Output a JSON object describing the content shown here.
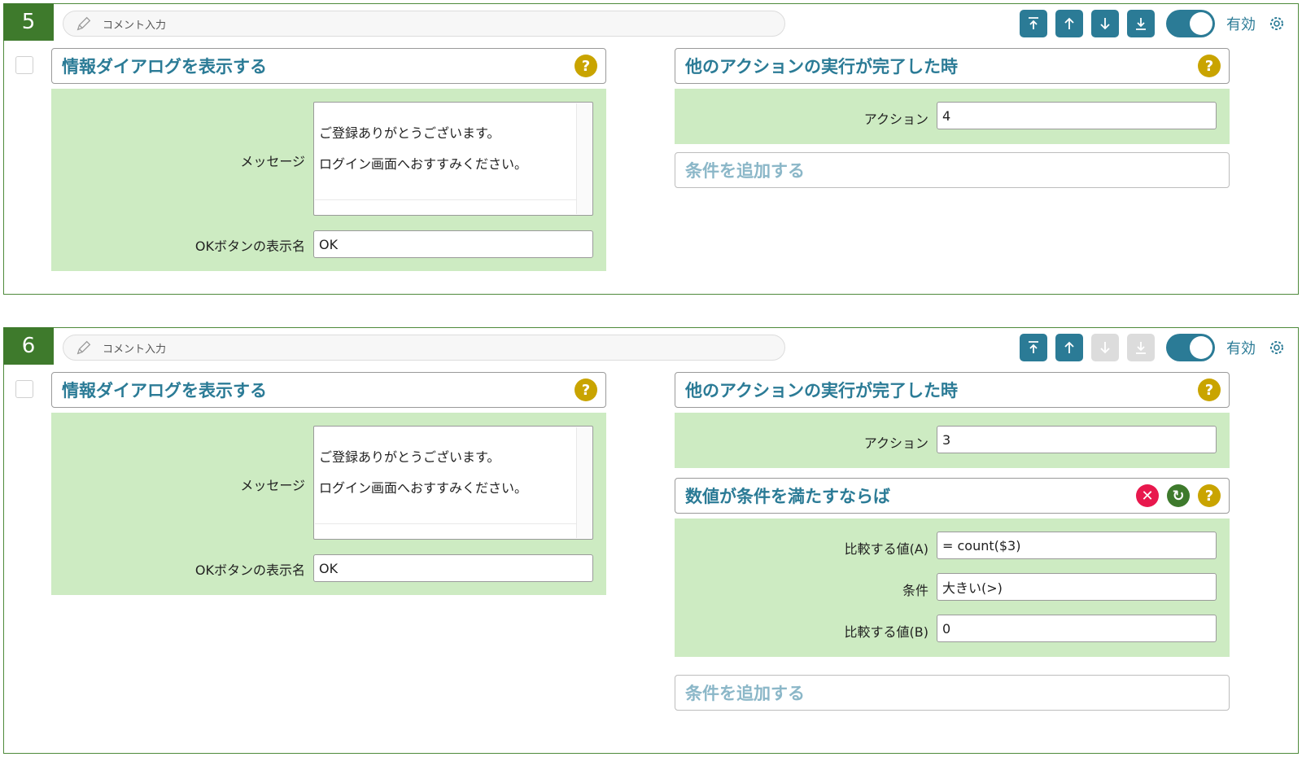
{
  "rows": [
    {
      "number": "5",
      "comment_placeholder": "コメント入力",
      "status_label": "有効",
      "action": {
        "title": "情報ダイアログを表示する",
        "message_label": "メッセージ",
        "message_lines": [
          "ご登録ありがとうございます。",
          "ログイン画面へおすすみください。"
        ],
        "ok_label": "OKボタンの表示名",
        "ok_value": "OK"
      },
      "trigger": {
        "title": "他のアクションの実行が完了した時",
        "action_label": "アクション",
        "action_value": "4"
      },
      "add_condition_label": "条件を追加する"
    },
    {
      "number": "6",
      "comment_placeholder": "コメント入力",
      "status_label": "有効",
      "action": {
        "title": "情報ダイアログを表示する",
        "message_label": "メッセージ",
        "message_lines": [
          "ご登録ありがとうございます。",
          "ログイン画面へおすすみください。"
        ],
        "ok_label": "OKボタンの表示名",
        "ok_value": "OK"
      },
      "trigger": {
        "title": "他のアクションの実行が完了した時",
        "action_label": "アクション",
        "action_value": "3"
      },
      "condition": {
        "title": "数値が条件を満たすならば",
        "a_label": "比較する値(A)",
        "a_value": "= count($3)",
        "op_label": "条件",
        "op_value": "大きい(>)",
        "b_label": "比較する値(B)",
        "b_value": "0"
      },
      "add_condition_label": "条件を追加する"
    }
  ],
  "colors": {
    "accent": "#2b7b96",
    "row_border": "#4e8a3b",
    "number_bg": "#3e7a2c",
    "panel_bg": "#cdebc2",
    "help": "#c9a400",
    "delete": "#e8184d",
    "disabled": "#dcdcdc"
  },
  "icons": [
    "pencil-icon",
    "move-top-icon",
    "move-up-icon",
    "move-down-icon",
    "move-bottom-icon",
    "gear-icon",
    "help-icon",
    "delete-icon",
    "refresh-icon"
  ]
}
